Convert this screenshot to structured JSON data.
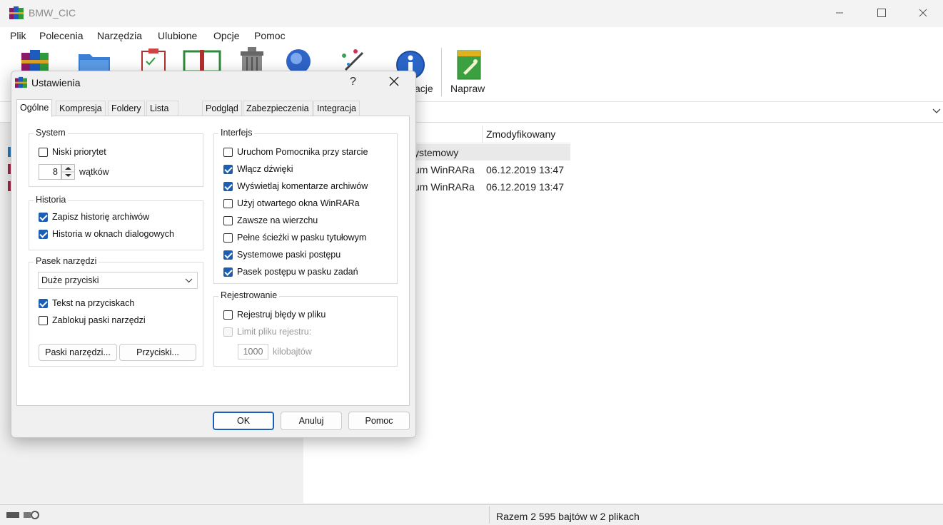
{
  "window": {
    "title": "BMW_CIC",
    "caption_buttons": [
      "minimize-icon",
      "maximize-icon",
      "close-icon"
    ]
  },
  "menu": [
    "Plik",
    "Polecenia",
    "Narzędzia",
    "Ulubione",
    "Opcje",
    "Pomoc"
  ],
  "toolbar": {
    "partial_label": "acje",
    "repair_label": "Napraw",
    "icons": [
      "add-icon",
      "extract-folder-icon",
      "test-icon",
      "view-icon",
      "delete-icon",
      "find-icon",
      "wizard-icon",
      "info-icon",
      "repair-icon"
    ]
  },
  "file_list": {
    "col_modified": "Zmodyfikowany",
    "rows": [
      {
        "name_partial": "ystemowy",
        "modified": ""
      },
      {
        "name_partial": "um WinRARa",
        "modified": "06.12.2019 13:47"
      },
      {
        "name_partial": "um WinRARa",
        "modified": "06.12.2019 13:47"
      }
    ]
  },
  "status": {
    "text": "Razem 2 595 bajtów w 2 plikach"
  },
  "dialog": {
    "title": "Ustawienia",
    "help": "?",
    "tabs": [
      "Ogólne",
      "Kompresja",
      "Foldery",
      "Lista plików",
      "Podgląd",
      "Zabezpieczenia",
      "Integracja"
    ],
    "system": {
      "label": "System",
      "low_priority": "Niski priorytet",
      "low_priority_checked": false,
      "threads_value": "8",
      "threads_label": "wątków"
    },
    "history": {
      "label": "Historia",
      "save_history": "Zapisz historię archiwów",
      "save_history_checked": true,
      "dialog_history": "Historia w oknach dialogowych",
      "dialog_history_checked": true
    },
    "toolbar_group": {
      "label": "Pasek narzędzi",
      "selected": "Duże przyciski",
      "text_on_buttons": "Tekst na przyciskach",
      "text_on_buttons_checked": true,
      "lock_toolbars": "Zablokuj paski narzędzi",
      "lock_toolbars_checked": false,
      "btn_toolbars": "Paski narzędzi...",
      "btn_buttons": "Przyciski..."
    },
    "interface": {
      "label": "Interfejs",
      "items": [
        {
          "label": "Uruchom Pomocnika przy starcie",
          "checked": false
        },
        {
          "label": "Włącz dźwięki",
          "checked": true
        },
        {
          "label": "Wyświetlaj komentarze archiwów",
          "checked": true
        },
        {
          "label": "Użyj otwartego okna WinRARa",
          "checked": false
        },
        {
          "label": "Zawsze na wierzchu",
          "checked": false
        },
        {
          "label": "Pełne ścieżki w pasku tytułowym",
          "checked": false
        },
        {
          "label": "Systemowe paski postępu",
          "checked": true
        },
        {
          "label": "Pasek postępu w pasku zadań",
          "checked": true
        }
      ]
    },
    "logging": {
      "label": "Rejestrowanie",
      "log_errors": "Rejestruj błędy w pliku",
      "log_errors_checked": false,
      "limit": "Limit pliku rejestru:",
      "limit_value": "1000",
      "limit_unit": "kilobajtów"
    },
    "buttons": {
      "ok": "OK",
      "cancel": "Anuluj",
      "help": "Pomoc"
    }
  }
}
